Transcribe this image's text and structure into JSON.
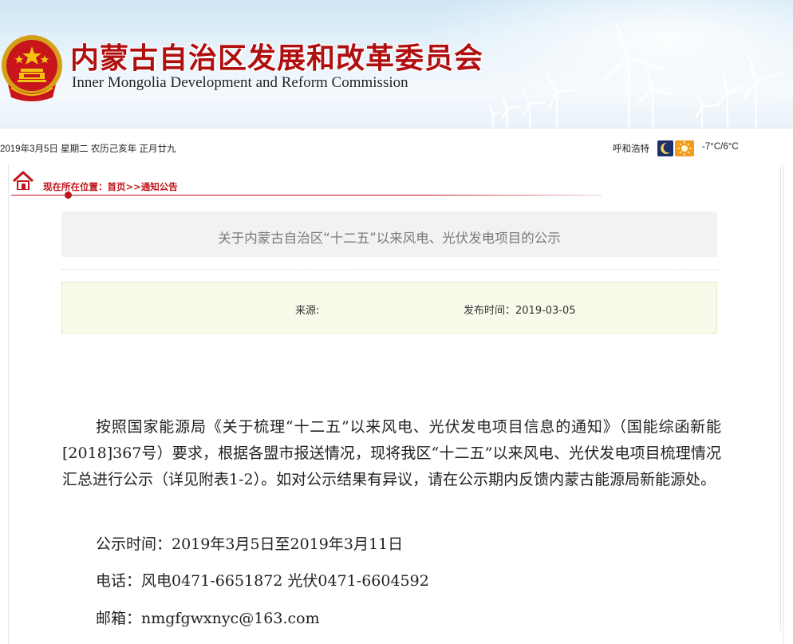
{
  "header": {
    "title_cn": "内蒙古自治区发展和改革委员会",
    "title_en": "Inner Mongolia Development  and Reform Commission",
    "emblem_icon": "national-emblem-icon",
    "brand_color": "#b00f0f"
  },
  "infobar": {
    "date": "2019年3月5日  星期二  农历己亥年  正月廿九",
    "weather": {
      "city": "呼和浩特",
      "night_icon": "moon-icon",
      "day_icon": "sun-icon",
      "temperature": "-7°C/6°C"
    }
  },
  "breadcrumb": {
    "icon": "home-icon",
    "text": "现在所在位置：首页>>通知公告",
    "color": "#c0141a"
  },
  "article": {
    "title": "关于内蒙古自治区“十二五”以来风电、光伏发电项目的公示",
    "source_label": "来源:",
    "publish_label": "发布时间：2019-03-05",
    "body_paragraph": "按照国家能源局《关于梳理“十二五”以来风电、光伏发电项目信息的通知》（国能综函新能[2018]367号）要求，根据各盟市报送情况，现将我区“十二五”以来风电、光伏发电项目梳理情况汇总进行公示（详见附表1-2）。如对公示结果有异议，请在公示期内反馈内蒙古能源局新能源处。",
    "notice_period": "公示时间：2019年3月5日至2019年3月11日",
    "phone": "电话：风电0471-6651872  光伏0471-6604592",
    "email": "邮箱：nmgfgwxnyc@163.com"
  }
}
